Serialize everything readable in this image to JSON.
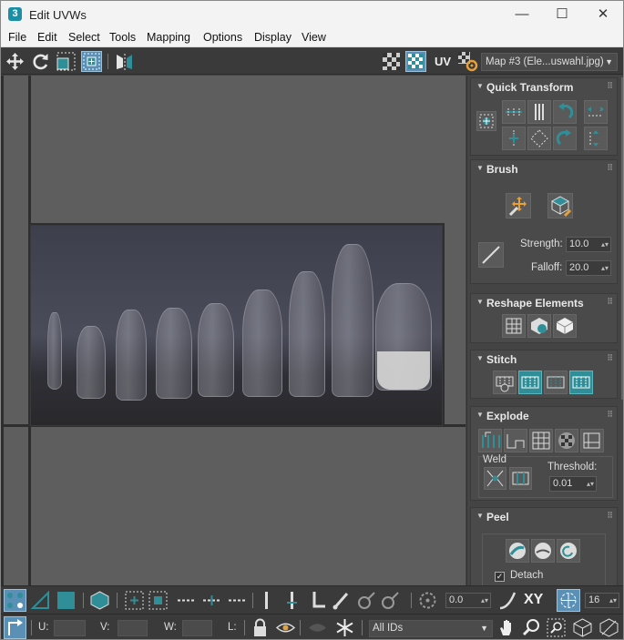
{
  "window": {
    "app_icon": "3",
    "title": "Edit UVWs",
    "minimize": "—",
    "maximize": "☐",
    "close": "✕"
  },
  "menu": [
    "File",
    "Edit",
    "Select",
    "Tools",
    "Mapping",
    "Options",
    "Display",
    "View"
  ],
  "toolbar": {
    "uv_label": "UV",
    "map_select": "Map #3 (Ele...uswahl.jpg)"
  },
  "panel": {
    "quick_transform": {
      "title": "Quick Transform"
    },
    "brush": {
      "title": "Brush",
      "strength_label": "Strength:",
      "strength_value": "10.0",
      "falloff_label": "Falloff:",
      "falloff_value": "20.0"
    },
    "reshape": {
      "title": "Reshape Elements"
    },
    "stitch": {
      "title": "Stitch"
    },
    "explode": {
      "title": "Explode",
      "weld_label": "Weld",
      "threshold_label": "Threshold:",
      "threshold_value": "0.01"
    },
    "peel": {
      "title": "Peel",
      "detach_label": "Detach",
      "detach_checked": true
    }
  },
  "bottom": {
    "rotate_value": "0.0",
    "xy_label": "XY",
    "grid_value": "16",
    "u_label": "U:",
    "v_label": "V:",
    "w_label": "W:",
    "l_label": "L:",
    "ids_select": "All IDs"
  },
  "colors": {
    "accent": "#2f8e97",
    "panel_bg": "#444444",
    "viewport_bg": "#5e5e5e"
  }
}
